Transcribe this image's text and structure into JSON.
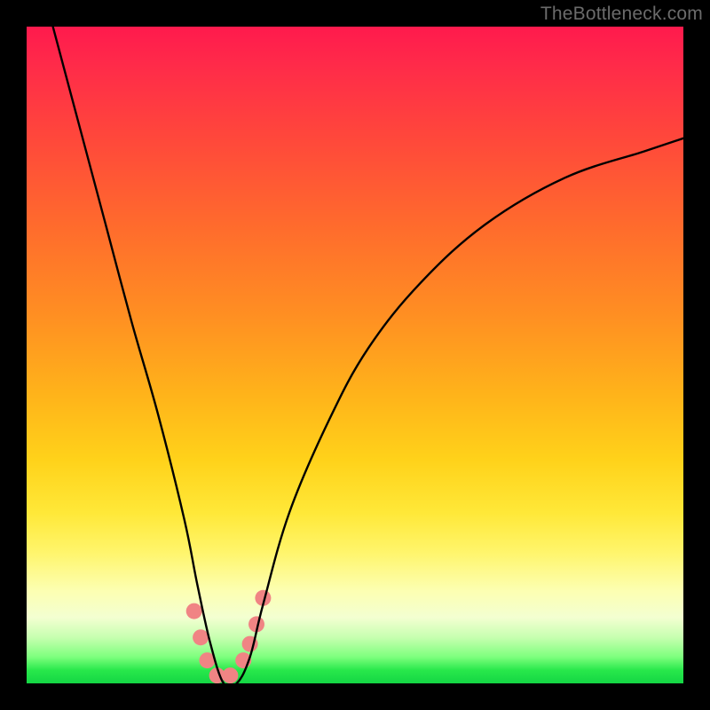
{
  "watermark": {
    "text": "TheBottleneck.com"
  },
  "colors": {
    "curve": "#000000",
    "marker": "#f08484",
    "background_black": "#000000"
  },
  "chart_data": {
    "type": "line",
    "title": "",
    "xlabel": "",
    "ylabel": "",
    "xlim": [
      0,
      100
    ],
    "ylim": [
      0,
      100
    ],
    "grid": false,
    "note": "V-shaped bottleneck curve over a red→green vertical gradient. y ≈ bottleneck percentage (0 at bottom, 100 at top). Minimum near x ≈ 30 where y ≈ 0. Values estimated from pixel positions.",
    "series": [
      {
        "name": "bottleneck-curve",
        "x": [
          4,
          8,
          12,
          16,
          20,
          24,
          26,
          28,
          30,
          32,
          34,
          36,
          40,
          46,
          52,
          60,
          70,
          82,
          94,
          100
        ],
        "y": [
          100,
          85,
          70,
          55,
          41,
          25,
          15,
          6,
          0,
          0,
          4,
          12,
          26,
          40,
          51,
          61,
          70,
          77,
          81,
          83
        ]
      }
    ],
    "markers": {
      "name": "highlight-points",
      "x": [
        25.5,
        26.5,
        27.5,
        29.0,
        31.0,
        33.0,
        34.0,
        35.0,
        36.0
      ],
      "y": [
        11,
        7,
        3.5,
        1.2,
        1.2,
        3.5,
        6,
        9,
        13
      ]
    }
  }
}
